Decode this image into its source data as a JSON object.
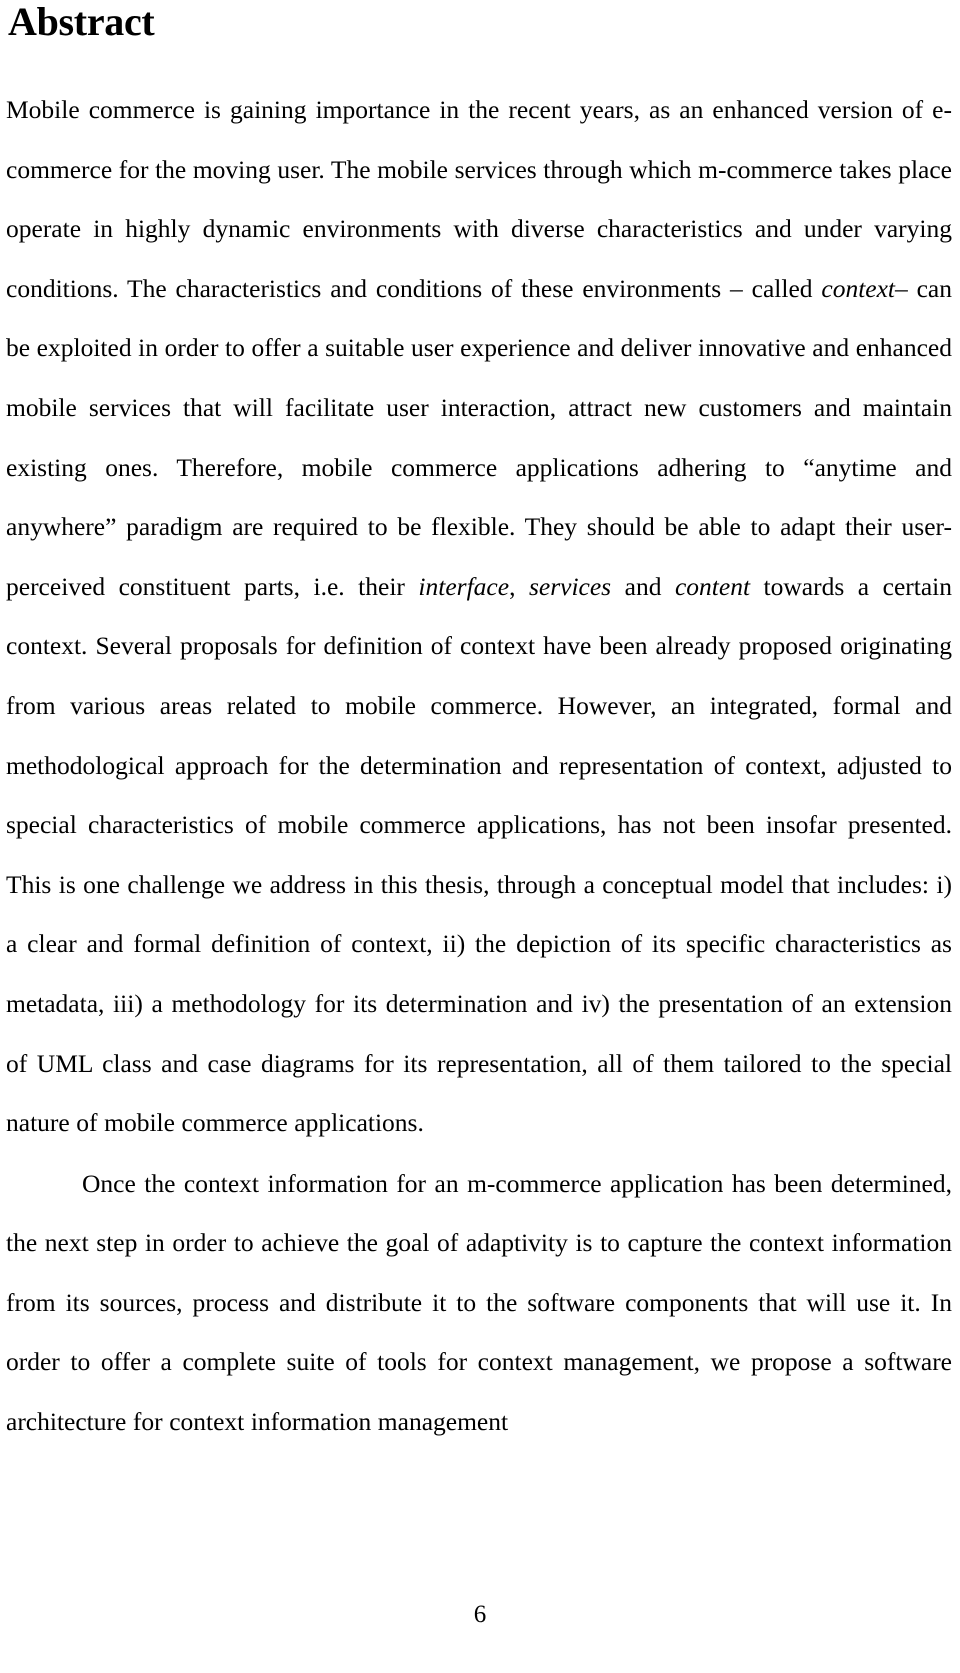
{
  "document": {
    "heading": "Abstract",
    "page_number": "6",
    "paragraphs": [
      {
        "id": "paragraph-1",
        "indented": false,
        "runs": [
          {
            "style": "roman",
            "text": "Mobile commerce is gaining importance in the recent years, as an enhanced version of e-commerce for the moving user. The mobile services through which m-commerce takes place operate in highly dynamic environments with diverse characteristics and under varying conditions. The characteristics and conditions of these environments – called "
          },
          {
            "style": "italic",
            "text": "context"
          },
          {
            "style": "roman",
            "text": "– can be exploited in order to offer a suitable user experience and deliver innovative and enhanced mobile services that will facilitate user interaction, attract new customers and maintain existing ones. Therefore, mobile commerce applications adhering to “anytime and anywhere” paradigm are required to be flexible. They should be able to adapt their user-perceived constituent parts, i.e. their "
          },
          {
            "style": "italic",
            "text": "interface"
          },
          {
            "style": "roman",
            "text": ", "
          },
          {
            "style": "italic",
            "text": "services"
          },
          {
            "style": "roman",
            "text": " and "
          },
          {
            "style": "italic",
            "text": "content"
          },
          {
            "style": "roman",
            "text": " towards a certain context. Several proposals for definition of context have been already proposed originating from various areas related to mobile commerce. However, an integrated, formal and methodological approach for the determination and representation of context, adjusted to special characteristics of mobile commerce applications, has not been insofar presented. This is one challenge we address in this thesis, through a conceptual model that includes: i) a clear and formal definition of context, ii) the depiction of its specific characteristics as metadata, iii) a methodology for its determination and iv) the presentation of an extension of UML class and case diagrams for its representation, all of them tailored to the special nature of mobile commerce applications."
          }
        ]
      },
      {
        "id": "paragraph-2",
        "indented": true,
        "runs": [
          {
            "style": "roman",
            "text": "Once the context information for an m-commerce application has been determined, the next step in order to achieve the goal of adaptivity is to capture the context information from its sources, process and distribute it to the software components that will use it. In order to offer a complete suite of tools for context management, we propose a software architecture for context information management"
          }
        ]
      }
    ]
  }
}
